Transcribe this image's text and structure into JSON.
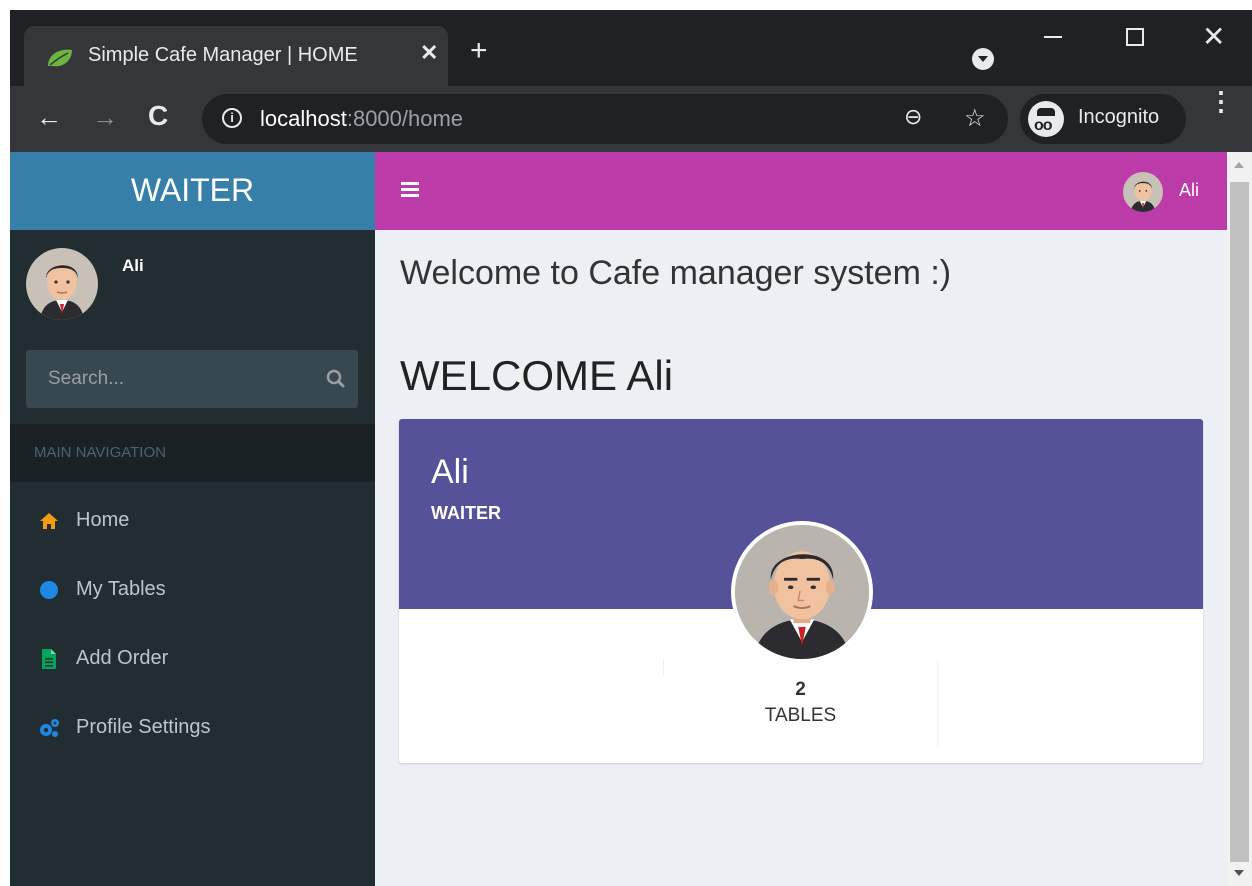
{
  "browser": {
    "tab_title": "Simple Cafe Manager | HOME",
    "tab_close": "✕",
    "new_tab": "+",
    "url_host": "localhost",
    "url_rest": ":8000/home",
    "profile_label": "Incognito",
    "back": "←",
    "forward": "→",
    "reload": "C",
    "zoom": "⊖",
    "star": "☆",
    "menu": "⋮",
    "close_window": "✕"
  },
  "app": {
    "brand": "WAITER",
    "user_name": "Ali",
    "search_placeholder": "Search...",
    "nav_header": "MAIN NAVIGATION",
    "nav_items": [
      {
        "label": "Home",
        "icon": "home-icon",
        "color": "#f39c12"
      },
      {
        "label": "My Tables",
        "icon": "circle-icon",
        "color": "#1e88e5"
      },
      {
        "label": "Add Order",
        "icon": "file-icon",
        "color": "#00a65a"
      },
      {
        "label": "Profile Settings",
        "icon": "cogs-icon",
        "color": "#1e88e5"
      }
    ],
    "header_user": "Ali",
    "header_color": "#bd3ba9",
    "brand_color": "#367fa9"
  },
  "content": {
    "title": "Welcome to Cafe manager system :)",
    "welcome": "WELCOME Ali",
    "card": {
      "name": "Ali",
      "role": "WAITER",
      "stat_value": "2",
      "stat_label": "TABLES",
      "color": "#555299"
    }
  }
}
